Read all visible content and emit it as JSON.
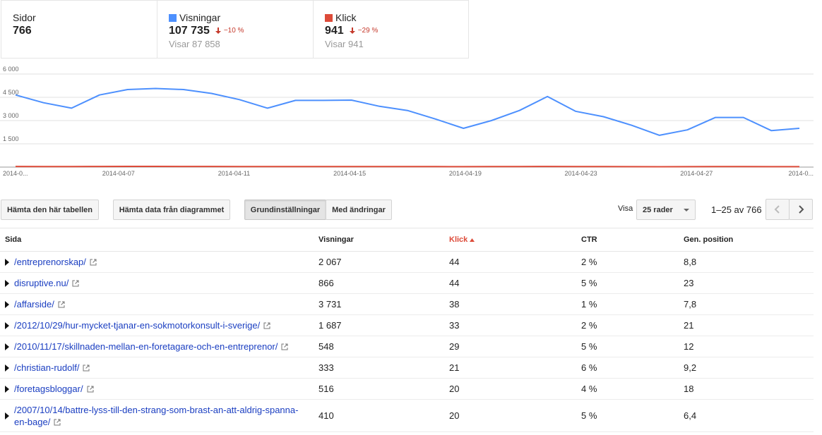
{
  "cards": [
    {
      "label": "Sidor",
      "value": "766"
    },
    {
      "label": "Visningar",
      "value": "107 735",
      "delta": "−10 %",
      "sub": "Visar 87 858",
      "color": "#4d90fe"
    },
    {
      "label": "Klick",
      "value": "941",
      "delta": "−29 %",
      "sub": "Visar 941",
      "color": "#dd4b39"
    }
  ],
  "chart_data": {
    "type": "line",
    "y_ticks": [
      "6 000",
      "4 500",
      "3 000",
      "1 500"
    ],
    "ylim": [
      0,
      6000
    ],
    "x_labels": [
      "2014-0...",
      "2014-04-07",
      "2014-04-11",
      "2014-04-15",
      "2014-04-19",
      "2014-04-23",
      "2014-04-27",
      "2014-0..."
    ],
    "x": [
      "2014-04-04",
      "2014-04-05",
      "2014-04-06",
      "2014-04-07",
      "2014-04-08",
      "2014-04-09",
      "2014-04-10",
      "2014-04-11",
      "2014-04-12",
      "2014-04-13",
      "2014-04-14",
      "2014-04-15",
      "2014-04-16",
      "2014-04-17",
      "2014-04-18",
      "2014-04-19",
      "2014-04-20",
      "2014-04-21",
      "2014-04-22",
      "2014-04-23",
      "2014-04-24",
      "2014-04-25",
      "2014-04-26",
      "2014-04-27",
      "2014-04-28",
      "2014-04-29",
      "2014-04-30",
      "2014-05-01"
    ],
    "series": [
      {
        "name": "Visningar",
        "color": "#4d90fe",
        "values": [
          4650,
          4150,
          3800,
          4650,
          5000,
          5070,
          5000,
          4750,
          4350,
          3800,
          4300,
          4300,
          4320,
          3920,
          3650,
          3100,
          2500,
          3000,
          3650,
          4550,
          3600,
          3250,
          2700,
          2050,
          2400,
          3200,
          3200,
          2350,
          2500
        ]
      },
      {
        "name": "Klick",
        "color": "#dd4b39",
        "values": [
          40,
          38,
          36,
          40,
          45,
          44,
          42,
          40,
          38,
          34,
          36,
          36,
          38,
          34,
          32,
          30,
          26,
          30,
          34,
          40,
          34,
          32,
          28,
          24,
          26,
          30,
          30,
          26,
          28
        ]
      }
    ]
  },
  "toolbar": {
    "download_table": "Hämta den här tabellen",
    "download_chart": "Hämta data från diagrammet",
    "default_settings": "Grundinställningar",
    "with_changes": "Med ändringar",
    "visa_label": "Visa",
    "rows_select": "25 rader",
    "pager": "1–25 av 766"
  },
  "table": {
    "headers": {
      "page": "Sida",
      "impressions": "Visningar",
      "clicks": "Klick",
      "ctr": "CTR",
      "position": "Gen. position"
    },
    "rows": [
      {
        "page": "/entreprenorskap/",
        "impressions": "2 067",
        "clicks": "44",
        "ctr": "2 %",
        "position": "8,8"
      },
      {
        "page": "disruptive.nu/",
        "impressions": "866",
        "clicks": "44",
        "ctr": "5 %",
        "position": "23"
      },
      {
        "page": "/affarside/",
        "impressions": "3 731",
        "clicks": "38",
        "ctr": "1 %",
        "position": "7,8"
      },
      {
        "page": "/2012/10/29/hur-mycket-tjanar-en-sokmotorkonsult-i-sverige/",
        "impressions": "1 687",
        "clicks": "33",
        "ctr": "2 %",
        "position": "21"
      },
      {
        "page": "/2010/11/17/skillnaden-mellan-en-foretagare-och-en-entreprenor/",
        "impressions": "548",
        "clicks": "29",
        "ctr": "5 %",
        "position": "12"
      },
      {
        "page": "/christian-rudolf/",
        "impressions": "333",
        "clicks": "21",
        "ctr": "6 %",
        "position": "9,2"
      },
      {
        "page": "/foretagsbloggar/",
        "impressions": "516",
        "clicks": "20",
        "ctr": "4 %",
        "position": "18"
      },
      {
        "page_line1": "/2007/10/14/battre-lyss-till-den-strang-som-brast-an-att-aldrig-spanna-",
        "page_line2": "en-bage/",
        "impressions": "410",
        "clicks": "20",
        "ctr": "5 %",
        "position": "6,4"
      }
    ]
  }
}
